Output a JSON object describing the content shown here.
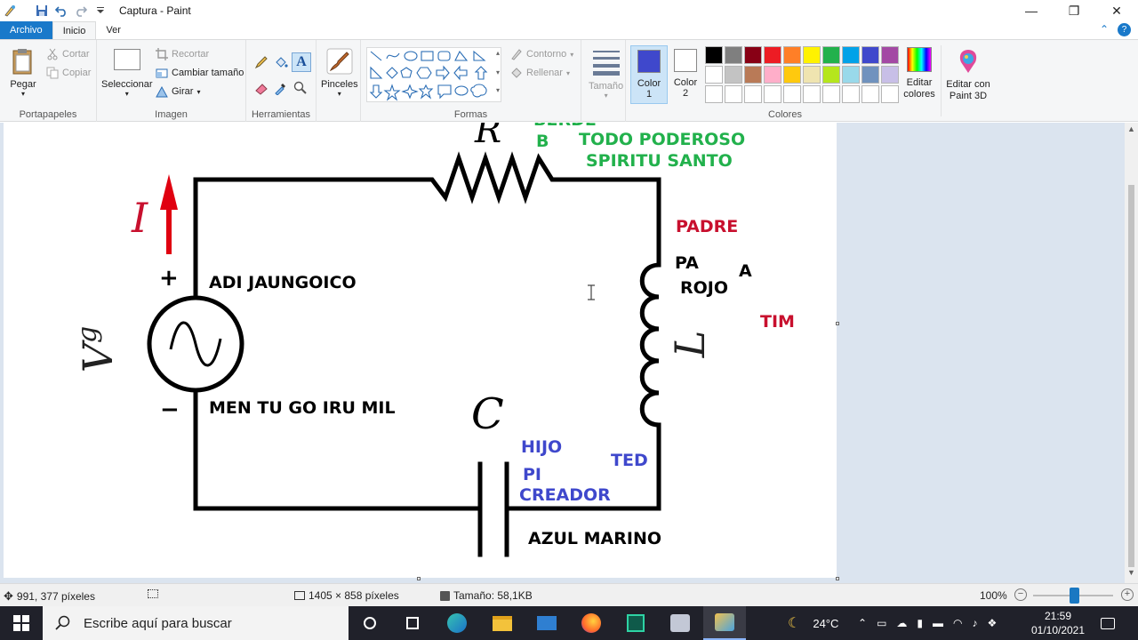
{
  "window": {
    "title": "Captura - Paint",
    "minimize": "—",
    "restore": "❐",
    "close": "✕"
  },
  "tabs": {
    "file": "Archivo",
    "home": "Inicio",
    "view": "Ver"
  },
  "ribbon": {
    "clipboard": {
      "label": "Portapapeles",
      "paste": "Pegar",
      "cut": "Cortar",
      "copy": "Copiar"
    },
    "image": {
      "label": "Imagen",
      "select": "Seleccionar",
      "crop": "Recortar",
      "resize": "Cambiar tamaño",
      "rotate": "Girar"
    },
    "tools": {
      "label": "Herramientas"
    },
    "brushes": {
      "label": "Pinceles"
    },
    "shapes": {
      "label": "Formas",
      "outline": "Contorno",
      "fill": "Rellenar"
    },
    "size": {
      "label": "Tamaño"
    },
    "color1": {
      "line1": "Color",
      "line2": "1",
      "value": "#3f48cc"
    },
    "color2": {
      "line1": "Color",
      "line2": "2",
      "value": "#ffffff"
    },
    "colors": {
      "label": "Colores"
    },
    "edit_colors": {
      "line1": "Editar",
      "line2": "colores"
    },
    "paint3d": {
      "line1": "Editar con",
      "line2": "Paint 3D"
    },
    "palette": [
      "#000000",
      "#7f7f7f",
      "#880015",
      "#ed1c24",
      "#ff7f27",
      "#fff200",
      "#22b14c",
      "#00a2e8",
      "#3f48cc",
      "#a349a4",
      "#ffffff",
      "#c3c3c3",
      "#b97a57",
      "#ffaec9",
      "#ffc90e",
      "#efe4b0",
      "#b5e61d",
      "#99d9ea",
      "#7092be",
      "#c8bfe7",
      "#ffffff",
      "#ffffff",
      "#ffffff",
      "#ffffff",
      "#ffffff",
      "#ffffff",
      "#ffffff",
      "#ffffff",
      "#ffffff",
      "#ffffff"
    ]
  },
  "canvas": {
    "labels": {
      "R": "R",
      "berde": "BERDE",
      "b": "B",
      "todo_poderoso": "TODO PODEROSO",
      "spiritu_santo": "SPIRITU SANTO",
      "I": "I",
      "padre": "PADRE",
      "pa": "PA",
      "a": "A",
      "rojo": "ROJO",
      "tim": "TIM",
      "plus": "+",
      "adi": "ADI JAUNGOICO",
      "vg_v": "V",
      "vg_g": "g",
      "L": "L",
      "minus": "−",
      "men": "MEN TU GO IRU MIL",
      "C": "C",
      "hijo": "HIJO",
      "ted": "TED",
      "pi": "PI",
      "creador": "CREADOR",
      "azul": "AZUL MARINO"
    },
    "colors": {
      "green": "#22b14c",
      "red": "#c8102e",
      "blue": "#3f48cc",
      "black": "#000000"
    }
  },
  "status": {
    "cursor": "991, 377 píxeles",
    "dimensions": "1405 × 858 píxeles",
    "size": "Tamaño: 58,1KB",
    "zoom": "100%"
  },
  "taskbar": {
    "search_placeholder": "Escribe aquí para buscar",
    "temperature": "24°C",
    "time": "21:59",
    "date": "01/10/2021"
  }
}
